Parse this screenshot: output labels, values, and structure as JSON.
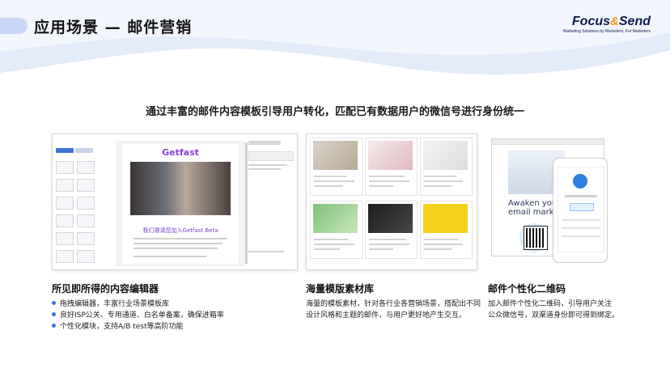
{
  "header": {
    "title": "应用场景 — 邮件营销",
    "logo_word": "Focus",
    "logo_amp": "&",
    "logo_word2": "Send",
    "logo_tagline": "Marketing Solutions by Marketers, For Marketers"
  },
  "subtitle": "通过丰富的邮件内容模板引导用户转化，匹配已有数据用户的微信号进行身份统一",
  "screens": {
    "editor": {
      "brand": "Getfast",
      "heading": "我们邀请您加入Getfast Beta"
    },
    "phone": {
      "headline_1": "Awaken your",
      "headline_2": "email marketing"
    }
  },
  "sections": [
    {
      "title": "所见即所得的内容编辑器",
      "items": [
        "拖拽编辑器，丰富行业场景模板库",
        "良好ISP公关、专用通道、白名单备案，确保进箱率",
        "个性化模块，支持A/B test等高阶功能"
      ]
    },
    {
      "title": "海量模版素材库",
      "lines": [
        "海量的模板素材，针对各行业各营销场景，搭配出不同",
        "设计风格和主题的邮件，与用户更好地产生交互。"
      ]
    },
    {
      "title": "邮件个性化二维码",
      "lines": [
        "加入邮件个性化二维码，引导用户关注",
        "公众微信号，双渠道身份即可得到绑定。"
      ]
    }
  ],
  "colors": {
    "accent": "#3f6fe0",
    "wave": "#e3eaf8",
    "brand_purple": "#7b3fd0",
    "logo_orange": "#f2a01b"
  }
}
